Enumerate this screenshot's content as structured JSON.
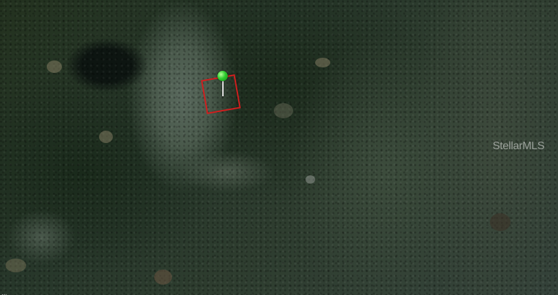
{
  "map": {
    "view": "satellite",
    "watermark": "StellarMLS",
    "attribution": "... ",
    "parcel_outline_color": "#d21e1e",
    "pin_color": "#2ecc2e",
    "pin_icon": "map-pin-icon"
  }
}
